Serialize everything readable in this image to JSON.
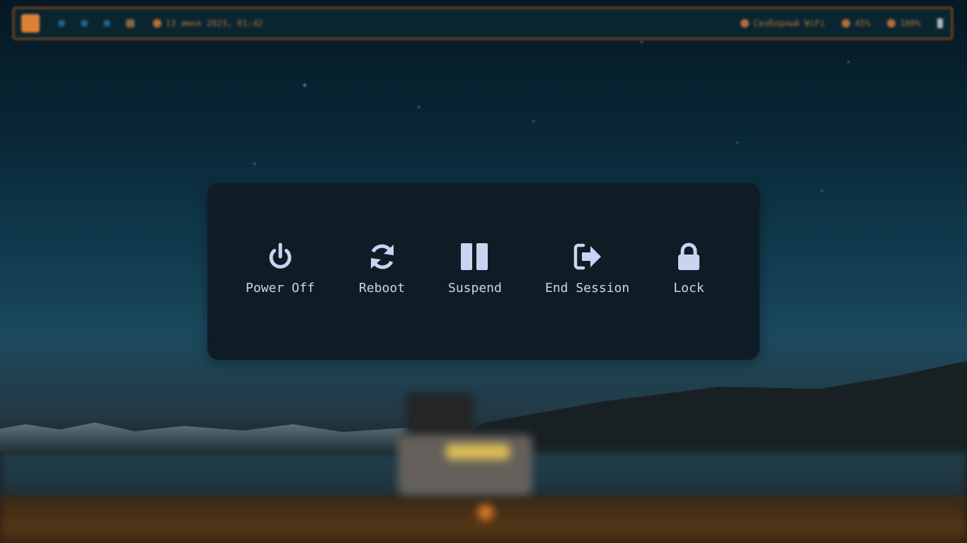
{
  "topbar": {
    "clock": "13 июня 2023, 01:42",
    "network": "Свободный WiFi",
    "volume": "45%",
    "brightness": "100%"
  },
  "power_menu": {
    "options": [
      {
        "label": "Power Off",
        "icon": "power-icon"
      },
      {
        "label": "Reboot",
        "icon": "reboot-icon"
      },
      {
        "label": "Suspend",
        "icon": "pause-icon"
      },
      {
        "label": "End Session",
        "icon": "logout-icon"
      },
      {
        "label": "Lock",
        "icon": "lock-icon"
      }
    ]
  },
  "colors": {
    "menu_bg": "#0e1d25",
    "icon": "#c9d4f3",
    "label": "#c9d4f3",
    "bar_border": "#b0561d",
    "bar_accent": "#e8893a"
  }
}
